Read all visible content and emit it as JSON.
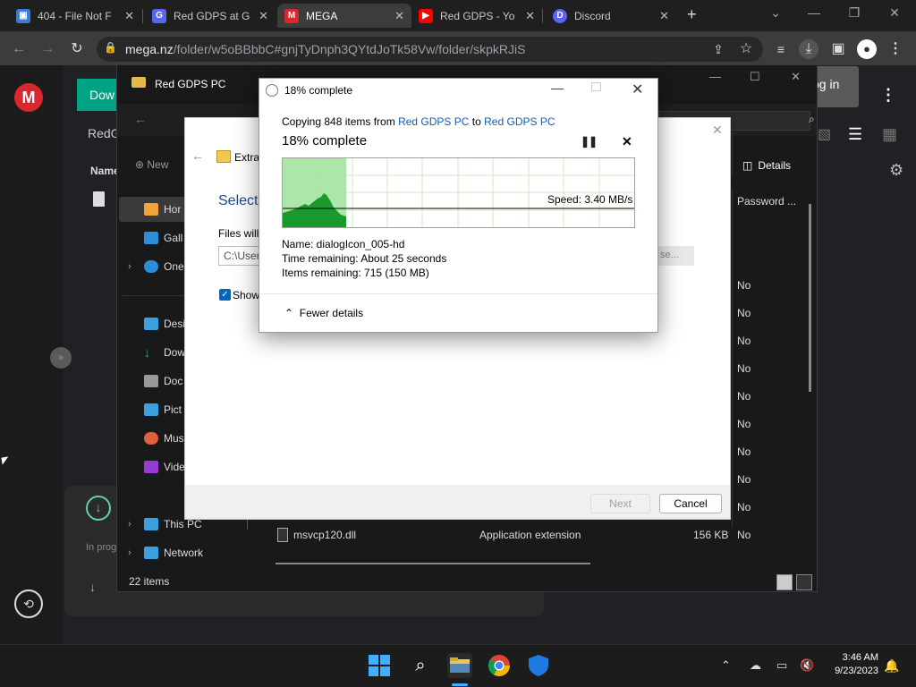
{
  "browser": {
    "tabs": [
      {
        "title": "404 - File Not F",
        "color": "#3a7bd5",
        "glyph": "▣"
      },
      {
        "title": "Red GDPS at G",
        "color": "#5865f2",
        "glyph": "G"
      },
      {
        "title": "MEGA",
        "color": "#d9272e",
        "glyph": "M"
      },
      {
        "title": "Red GDPS - Yo",
        "color": "#ff0000",
        "glyph": "▶"
      },
      {
        "title": "Discord",
        "color": "#5865f2",
        "glyph": "D"
      }
    ],
    "new_tab": "+",
    "url_host": "mega.nz",
    "url_path": "/folder/w5oBBbbC#gnjTyDnph3QYtdJoTk58Vw/folder/skpkRJiS"
  },
  "mega": {
    "logo": "M",
    "download_label": "Dow",
    "login_label": "og in",
    "folder_label": "RedG",
    "name_header": "Name",
    "in_progress": "In prog"
  },
  "explorer": {
    "title": "Red GDPS PC",
    "new_label": "New",
    "details_label": "Details",
    "password_header": "Password ...",
    "nav_items": [
      {
        "label": "Hor",
        "color": "#f2a33a"
      },
      {
        "label": "Gall",
        "color": "#2c8ed6"
      },
      {
        "label": "One",
        "color": "#2c8ed6",
        "chev": "›"
      },
      {
        "label": "Desi",
        "color": "#3aa0e0"
      },
      {
        "label": "Dow",
        "color": "#3ab06a"
      },
      {
        "label": "Doc",
        "color": "#999999"
      },
      {
        "label": "Pict",
        "color": "#3aa0e0"
      },
      {
        "label": "Mus",
        "color": "#e0603a"
      },
      {
        "label": "Vide",
        "color": "#9a3ad6"
      },
      {
        "label": "This PC",
        "color": "#3aa0e0",
        "chev": "›"
      },
      {
        "label": "Network",
        "color": "#3aa0e0",
        "chev": "›"
      }
    ],
    "password_values": [
      "No",
      "No",
      "No",
      "No",
      "No",
      "No",
      "No",
      "No",
      "No",
      "No"
    ],
    "file_row": {
      "name": "msvcp120.dll",
      "type": "Application extension",
      "size": "156 KB",
      "password": "No"
    },
    "status_count": "22 items"
  },
  "extract": {
    "title": "Extra",
    "heading": "Select",
    "files_will": "Files will",
    "path": "C:\\User",
    "browse": "se...",
    "show_label": "Show",
    "next": "Next",
    "cancel": "Cancel"
  },
  "copy": {
    "window_title": "18% complete",
    "line_prefix": "Copying 848 items from",
    "source": "Red GDPS PC",
    "to_word": "to",
    "dest": "Red GDPS PC",
    "percent_text": "18% complete",
    "progress": 0.18,
    "speed": "Speed: 3.40 MB/s",
    "name_line": "Name:  dialogIcon_005-hd",
    "time_line": "Time remaining:  About 25 seconds",
    "items_line": "Items remaining:  715 (150 MB)",
    "fewer_details": "Fewer details"
  },
  "taskbar": {
    "time": "3:46 AM",
    "date": "9/23/2023"
  }
}
